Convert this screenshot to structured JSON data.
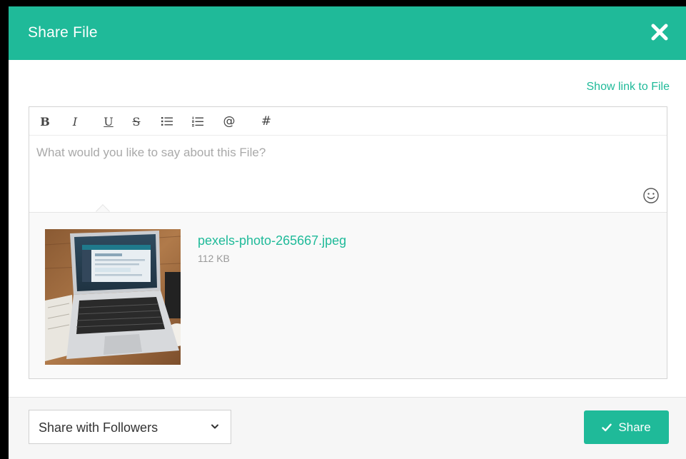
{
  "dialog": {
    "title": "Share File",
    "close_icon": "close-icon"
  },
  "show_link": "Show link to File",
  "editor": {
    "toolbar": [
      {
        "name": "bold",
        "glyph": "B"
      },
      {
        "name": "italic",
        "glyph": "I"
      },
      {
        "name": "underline",
        "glyph": "U"
      },
      {
        "name": "strikethrough",
        "glyph": "S"
      },
      {
        "name": "bullet-list",
        "glyph": "bullet-list-icon"
      },
      {
        "name": "numbered-list",
        "glyph": "numbered-list-icon"
      },
      {
        "name": "mention",
        "glyph": "@"
      },
      {
        "name": "hashtag",
        "glyph": "#"
      }
    ],
    "placeholder": "What would you like to say about this File?",
    "value": "",
    "emoji_icon": "smiley-icon"
  },
  "attachment": {
    "file_name": "pexels-photo-265667.jpeg",
    "file_size": "112 KB",
    "thumbnail_icon": "laptop-photo-thumbnail"
  },
  "footer": {
    "visibility_selected": "Share with Followers",
    "share_label": "Share",
    "share_icon": "checkmark-icon"
  },
  "colors": {
    "accent": "#1fba99",
    "footer_bg": "#f6f6f6",
    "attachment_bg": "#f9f9f9"
  }
}
